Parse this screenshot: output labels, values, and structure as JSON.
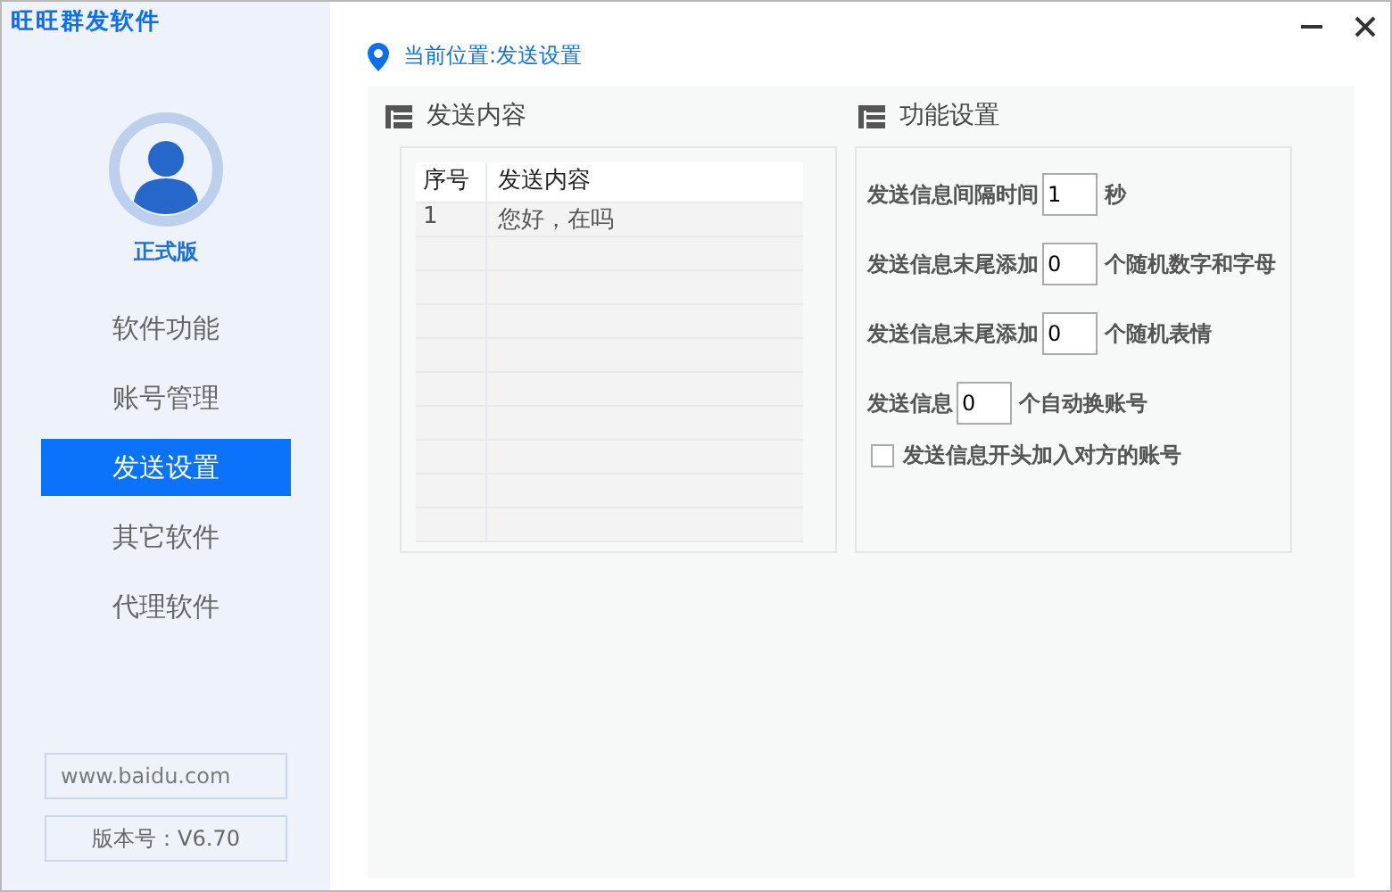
{
  "window": {
    "title": "旺旺群发软件"
  },
  "profile": {
    "edition": "正式版"
  },
  "sidebar": {
    "items": [
      {
        "label": "软件功能",
        "selected": false
      },
      {
        "label": "账号管理",
        "selected": false
      },
      {
        "label": "发送设置",
        "selected": true
      },
      {
        "label": "其它软件",
        "selected": false
      },
      {
        "label": "代理软件",
        "selected": false
      }
    ],
    "website": "www.baidu.com",
    "version": "版本号：V6.70"
  },
  "breadcrumb": "当前位置:发送设置",
  "content_panel": {
    "title": "发送内容",
    "table": {
      "columns": [
        "序号",
        "发送内容"
      ],
      "rows": [
        [
          "1",
          "您好，在吗"
        ]
      ]
    }
  },
  "settings_panel": {
    "title": "功能设置",
    "rows": [
      {
        "label": "发送信息间隔时间",
        "value": "1",
        "suffix": "秒"
      },
      {
        "label": "发送信息末尾添加",
        "value": "0",
        "suffix": "个随机数字和字母"
      },
      {
        "label": "发送信息末尾添加",
        "value": "0",
        "suffix": "个随机表情"
      },
      {
        "label": "发送信息",
        "value": "0",
        "suffix": "个自动换账号"
      }
    ],
    "checkbox": {
      "label": "发送信息开头加入对方的账号",
      "checked": false
    }
  }
}
